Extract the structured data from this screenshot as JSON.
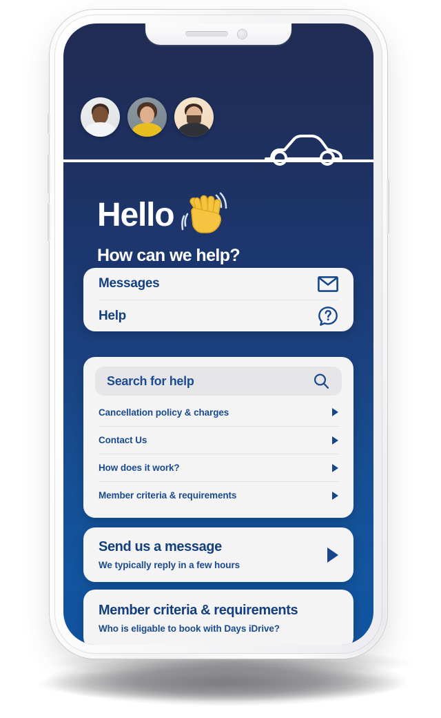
{
  "screen": {
    "greeting": {
      "title": "Hello",
      "emoji": "waving-hand",
      "subtitle": "How can we help?"
    },
    "header": {
      "avatars": [
        "avatar-person-1",
        "avatar-person-2",
        "avatar-person-3"
      ],
      "illustration": "car-outline-icon"
    },
    "quick_links": {
      "items": [
        {
          "label": "Messages",
          "icon": "envelope-icon"
        },
        {
          "label": "Help",
          "icon": "question-bubble-icon"
        }
      ]
    },
    "search": {
      "placeholder": "Search for help",
      "icon": "search-icon"
    },
    "faq": {
      "items": [
        "Cancellation policy & charges",
        "Contact Us",
        "How does it work?",
        "Member criteria & requirements"
      ]
    },
    "send_message_card": {
      "title": "Send us a message",
      "subtitle": "We typically reply in a few hours",
      "icon": "play-arrow-icon"
    },
    "member_card": {
      "title": "Member criteria & requirements",
      "subtitle": "Who is eligable to book with Days iDrive?"
    }
  },
  "colors": {
    "gradient_top": "#202c53",
    "gradient_bottom": "#10549f",
    "card_bg": "#f4f4f5",
    "text_primary": "#14407e",
    "accent": "#17468a",
    "emoji_yellow": "#f5c542"
  }
}
